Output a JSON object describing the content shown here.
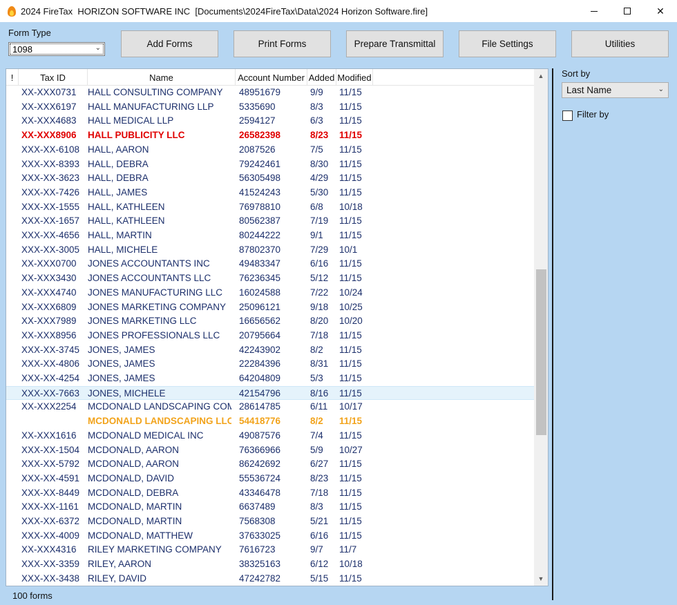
{
  "window": {
    "title": "2024 FireTax  HORIZON SOFTWARE INC  [Documents\\2024FireTax\\Data\\2024 Horizon Software.fire]"
  },
  "toolbar": {
    "form_type_label": "Form Type",
    "form_type_value": "1098",
    "buttons": [
      "Add Forms",
      "Print Forms",
      "Prepare Transmittal",
      "File Settings",
      "Utilities"
    ]
  },
  "table": {
    "headers": [
      "!",
      "Tax ID",
      "Name",
      "Account Number",
      "Added",
      "Modified"
    ],
    "rows": [
      {
        "tax_id": "XX-XXX0731",
        "name": "HALL CONSULTING COMPANY",
        "account": "48951679",
        "added": "9/9",
        "modified": "11/15",
        "style": ""
      },
      {
        "tax_id": "XX-XXX6197",
        "name": "HALL MANUFACTURING LLP",
        "account": "5335690",
        "added": "8/3",
        "modified": "11/15",
        "style": ""
      },
      {
        "tax_id": "XX-XXX4683",
        "name": "HALL MEDICAL LLP",
        "account": "2594127",
        "added": "6/3",
        "modified": "11/15",
        "style": ""
      },
      {
        "tax_id": "XX-XXX8906",
        "name": "HALL PUBLICITY LLC",
        "account": "26582398",
        "added": "8/23",
        "modified": "11/15",
        "style": "red"
      },
      {
        "tax_id": "XXX-XX-6108",
        "name": "HALL, AARON",
        "account": "2087526",
        "added": "7/5",
        "modified": "11/15",
        "style": ""
      },
      {
        "tax_id": "XXX-XX-8393",
        "name": "HALL, DEBRA",
        "account": "79242461",
        "added": "8/30",
        "modified": "11/15",
        "style": ""
      },
      {
        "tax_id": "XXX-XX-3623",
        "name": "HALL, DEBRA",
        "account": "56305498",
        "added": "4/29",
        "modified": "11/15",
        "style": ""
      },
      {
        "tax_id": "XXX-XX-7426",
        "name": "HALL, JAMES",
        "account": "41524243",
        "added": "5/30",
        "modified": "11/15",
        "style": ""
      },
      {
        "tax_id": "XXX-XX-1555",
        "name": "HALL, KATHLEEN",
        "account": "76978810",
        "added": "6/8",
        "modified": "10/18",
        "style": ""
      },
      {
        "tax_id": "XXX-XX-1657",
        "name": "HALL, KATHLEEN",
        "account": "80562387",
        "added": "7/19",
        "modified": "11/15",
        "style": ""
      },
      {
        "tax_id": "XXX-XX-4656",
        "name": "HALL, MARTIN",
        "account": "80244222",
        "added": "9/1",
        "modified": "11/15",
        "style": ""
      },
      {
        "tax_id": "XXX-XX-3005",
        "name": "HALL, MICHELE",
        "account": "87802370",
        "added": "7/29",
        "modified": "10/1",
        "style": ""
      },
      {
        "tax_id": "XX-XXX0700",
        "name": "JONES ACCOUNTANTS INC",
        "account": "49483347",
        "added": "6/16",
        "modified": "11/15",
        "style": ""
      },
      {
        "tax_id": "XX-XXX3430",
        "name": "JONES ACCOUNTANTS LLC",
        "account": "76236345",
        "added": "5/12",
        "modified": "11/15",
        "style": ""
      },
      {
        "tax_id": "XX-XXX4740",
        "name": "JONES MANUFACTURING LLC",
        "account": "16024588",
        "added": "7/22",
        "modified": "10/24",
        "style": ""
      },
      {
        "tax_id": "XX-XXX6809",
        "name": "JONES MARKETING COMPANY",
        "account": "25096121",
        "added": "9/18",
        "modified": "10/25",
        "style": ""
      },
      {
        "tax_id": "XX-XXX7989",
        "name": "JONES MARKETING LLC",
        "account": "16656562",
        "added": "8/20",
        "modified": "10/20",
        "style": ""
      },
      {
        "tax_id": "XX-XXX8956",
        "name": "JONES PROFESSIONALS LLC",
        "account": "20795664",
        "added": "7/18",
        "modified": "11/15",
        "style": ""
      },
      {
        "tax_id": "XXX-XX-3745",
        "name": "JONES, JAMES",
        "account": "42243902",
        "added": "8/2",
        "modified": "11/15",
        "style": ""
      },
      {
        "tax_id": "XXX-XX-4806",
        "name": "JONES, JAMES",
        "account": "22284396",
        "added": "8/31",
        "modified": "11/15",
        "style": ""
      },
      {
        "tax_id": "XXX-XX-4254",
        "name": "JONES, JAMES",
        "account": "64204809",
        "added": "5/3",
        "modified": "11/15",
        "style": ""
      },
      {
        "tax_id": "XXX-XX-7663",
        "name": "JONES, MICHELE",
        "account": "42154796",
        "added": "8/16",
        "modified": "11/15",
        "style": "selected"
      },
      {
        "tax_id": "XX-XXX2254",
        "name": "MCDONALD LANDSCAPING COM",
        "account": "28614785",
        "added": "6/11",
        "modified": "10/17",
        "style": ""
      },
      {
        "tax_id": "",
        "name": "MCDONALD LANDSCAPING LLC",
        "account": "54418776",
        "added": "8/2",
        "modified": "11/15",
        "style": "orange"
      },
      {
        "tax_id": "XX-XXX1616",
        "name": "MCDONALD MEDICAL INC",
        "account": "49087576",
        "added": "7/4",
        "modified": "11/15",
        "style": ""
      },
      {
        "tax_id": "XXX-XX-1504",
        "name": "MCDONALD, AARON",
        "account": "76366966",
        "added": "5/9",
        "modified": "10/27",
        "style": ""
      },
      {
        "tax_id": "XXX-XX-5792",
        "name": "MCDONALD, AARON",
        "account": "86242692",
        "added": "6/27",
        "modified": "11/15",
        "style": ""
      },
      {
        "tax_id": "XXX-XX-4591",
        "name": "MCDONALD, DAVID",
        "account": "55536724",
        "added": "8/23",
        "modified": "11/15",
        "style": ""
      },
      {
        "tax_id": "XXX-XX-8449",
        "name": "MCDONALD, DEBRA",
        "account": "43346478",
        "added": "7/18",
        "modified": "11/15",
        "style": ""
      },
      {
        "tax_id": "XXX-XX-1161",
        "name": "MCDONALD, MARTIN",
        "account": "6637489",
        "added": "8/3",
        "modified": "11/15",
        "style": ""
      },
      {
        "tax_id": "XXX-XX-6372",
        "name": "MCDONALD, MARTIN",
        "account": "7568308",
        "added": "5/21",
        "modified": "11/15",
        "style": ""
      },
      {
        "tax_id": "XXX-XX-4009",
        "name": "MCDONALD, MATTHEW",
        "account": "37633025",
        "added": "6/16",
        "modified": "11/15",
        "style": ""
      },
      {
        "tax_id": "XX-XXX4316",
        "name": "RILEY MARKETING COMPANY",
        "account": "7616723",
        "added": "9/7",
        "modified": "11/7",
        "style": ""
      },
      {
        "tax_id": "XXX-XX-3359",
        "name": "RILEY, AARON",
        "account": "38325163",
        "added": "6/12",
        "modified": "10/18",
        "style": ""
      },
      {
        "tax_id": "XXX-XX-3438",
        "name": "RILEY, DAVID",
        "account": "47242782",
        "added": "5/15",
        "modified": "11/15",
        "style": ""
      }
    ],
    "footer": "100 forms"
  },
  "sidebar": {
    "sort_by_label": "Sort by",
    "sort_by_value": "Last Name",
    "filter_by_label": "Filter by"
  }
}
